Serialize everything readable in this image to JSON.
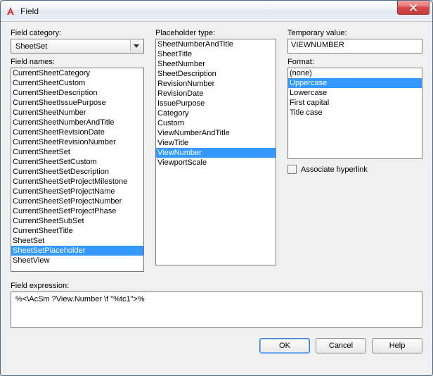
{
  "window": {
    "title": "Field"
  },
  "col1": {
    "category_label": "Field category:",
    "category_value": "SheetSet",
    "names_label": "Field names:",
    "names": [
      "CurrentSheetCategory",
      "CurrentSheetCustom",
      "CurrentSheetDescription",
      "CurrentSheetIssuePurpose",
      "CurrentSheetNumber",
      "CurrentSheetNumberAndTitle",
      "CurrentSheetRevisionDate",
      "CurrentSheetRevisionNumber",
      "CurrentSheetSet",
      "CurrentSheetSetCustom",
      "CurrentSheetSetDescription",
      "CurrentSheetSetProjectMilestone",
      "CurrentSheetSetProjectName",
      "CurrentSheetSetProjectNumber",
      "CurrentSheetSetProjectPhase",
      "CurrentSheetSubSet",
      "CurrentSheetTitle",
      "SheetSet",
      "SheetSetPlaceholder",
      "SheetView"
    ],
    "names_selected": "SheetSetPlaceholder"
  },
  "col2": {
    "ph_label": "Placeholder type:",
    "placeholders": [
      "SheetNumberAndTitle",
      "SheetTitle",
      "SheetNumber",
      "SheetDescription",
      "RevisionNumber",
      "RevisionDate",
      "IssuePurpose",
      "Category",
      "Custom",
      "ViewNumberAndTitle",
      "ViewTitle",
      "ViewNumber",
      "ViewportScale"
    ],
    "ph_selected": "ViewNumber"
  },
  "col3": {
    "temp_label": "Temporary value:",
    "temp_value": "VIEWNUMBER",
    "format_label": "Format:",
    "formats": [
      "(none)",
      "Uppercase",
      "Lowercase",
      "First capital",
      "Title case"
    ],
    "format_selected": "Uppercase",
    "assoc_label": "Associate hyperlink"
  },
  "expr": {
    "label": "Field expression:",
    "value": "%<\\AcSm ?View.Number \\f \"%tc1\">%"
  },
  "buttons": {
    "ok": "OK",
    "cancel": "Cancel",
    "help": "Help"
  }
}
